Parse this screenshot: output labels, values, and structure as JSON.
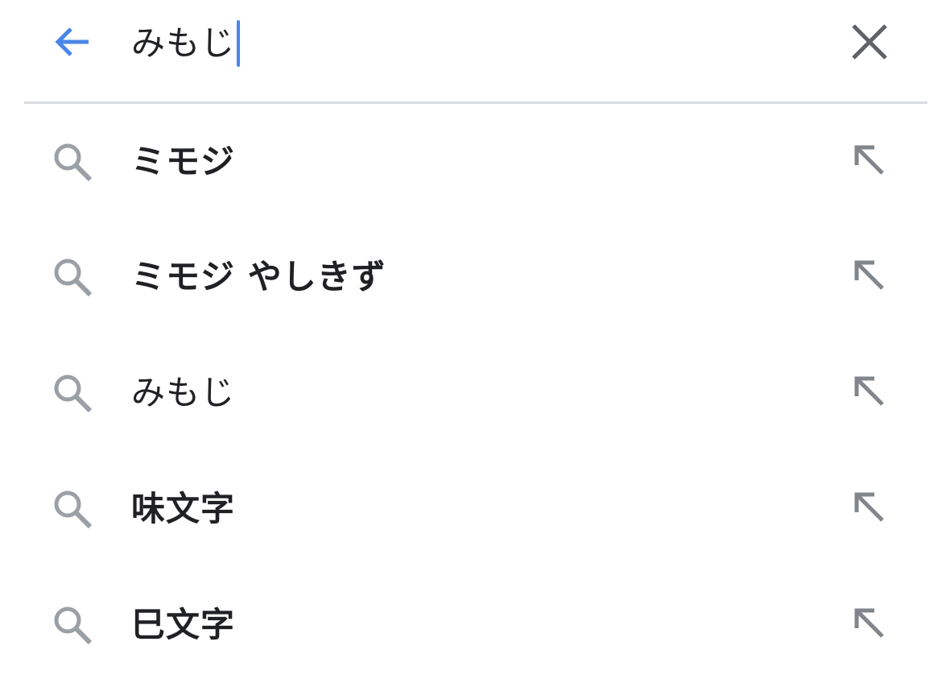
{
  "search": {
    "query": "みもじ",
    "back_icon": "arrow-left-icon",
    "clear_icon": "close-icon",
    "accent_color": "#4a86e8"
  },
  "suggestions": [
    {
      "text": "ミモジ",
      "bold": true,
      "icon": "search-icon",
      "action_icon": "arrow-up-left-icon"
    },
    {
      "text": "ミモジ やしきず",
      "bold": true,
      "icon": "search-icon",
      "action_icon": "arrow-up-left-icon"
    },
    {
      "text": "みもじ",
      "bold": false,
      "icon": "search-icon",
      "action_icon": "arrow-up-left-icon"
    },
    {
      "text": "味文字",
      "bold": true,
      "icon": "search-icon",
      "action_icon": "arrow-up-left-icon"
    },
    {
      "text": "巳文字",
      "bold": true,
      "icon": "search-icon",
      "action_icon": "arrow-up-left-icon"
    }
  ]
}
